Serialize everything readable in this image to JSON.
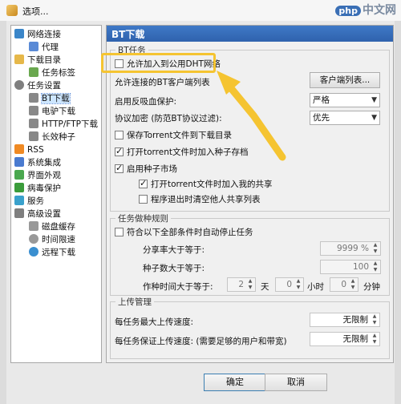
{
  "window": {
    "title": "选项..."
  },
  "watermark": {
    "badge": "php",
    "text": "中文网"
  },
  "tree": {
    "items": [
      {
        "label": "网络连接",
        "icon": "network-icon",
        "color": "#3b86c9"
      },
      {
        "label": "代理",
        "icon": "proxy-icon",
        "color": "#5a8ad6"
      },
      {
        "label": "下载目录",
        "icon": "folder-icon",
        "color": "#e6b84a"
      },
      {
        "label": "任务标签",
        "icon": "tag-icon",
        "color": "#6aa84f"
      },
      {
        "label": "任务设置",
        "icon": "gear-icon",
        "color": "#7f7f7f"
      },
      {
        "label": "BT下载",
        "icon": "bt-icon",
        "color": "#888888"
      },
      {
        "label": "电驴下载",
        "icon": "ed2k-icon",
        "color": "#888888"
      },
      {
        "label": "HTTP/FTP下载",
        "icon": "http-icon",
        "color": "#888888"
      },
      {
        "label": "长效种子",
        "icon": "seed-icon",
        "color": "#888888"
      },
      {
        "label": "RSS",
        "icon": "rss-icon",
        "color": "#f08a24"
      },
      {
        "label": "系统集成",
        "icon": "integration-icon",
        "color": "#4a7bd0"
      },
      {
        "label": "界面外观",
        "icon": "appearance-icon",
        "color": "#4aa84f"
      },
      {
        "label": "病毒保护",
        "icon": "shield-icon",
        "color": "#3b9c3b"
      },
      {
        "label": "服务",
        "icon": "service-icon",
        "color": "#3aa1cc"
      },
      {
        "label": "高级设置",
        "icon": "advanced-icon",
        "color": "#7f7f7f"
      },
      {
        "label": "磁盘缓存",
        "icon": "disk-cache-icon",
        "color": "#999999"
      },
      {
        "label": "时间限速",
        "icon": "clock-icon",
        "color": "#999999"
      },
      {
        "label": "远程下载",
        "icon": "remote-icon",
        "color": "#3a8fd0"
      }
    ]
  },
  "panel": {
    "header": "BT下载",
    "bt_group": {
      "title": "BT任务",
      "dht_checkbox": {
        "label": "允许加入到公用DHT网络",
        "checked": false
      },
      "client_list_label": "允许连接的BT客户端列表",
      "client_list_button": "客户端列表...",
      "anti_leech_label": "启用反吸血保护:",
      "anti_leech_value": "严格",
      "protocol_label": "协议加密 (防范BT协议过滤):",
      "protocol_value": "优先",
      "save_torrent": {
        "label": "保存Torrent文件到下载目录",
        "checked": false
      },
      "open_torrent": {
        "label": "打开torrent文件时加入种子存档",
        "checked": true
      },
      "seed_market": {
        "label": "启用种子市场",
        "checked": true
      },
      "share_on_open": {
        "label": "打开torrent文件时加入我的共享",
        "checked": true
      },
      "clear_on_exit": {
        "label": "程序退出时清空他人共享列表",
        "checked": false
      }
    },
    "seed_rule_group": {
      "title": "任务做种规则",
      "stop_checkbox": {
        "label": "符合以下全部条件时自动停止任务",
        "checked": false
      },
      "share_ratio_label": "分享率大于等于:",
      "share_ratio_value": "9999 %",
      "seed_count_label": "种子数大于等于:",
      "seed_count_value": "100",
      "seed_time_label": "作种时间大于等于:",
      "days_value": "2",
      "days_unit": "天",
      "hours_value": "0",
      "hours_unit": "小时",
      "minutes_value": "0",
      "minutes_unit": "分钟"
    },
    "upload_group": {
      "title": "上传管理",
      "max_upload_label": "每任务最大上传速度:",
      "max_upload_value": "无限制",
      "min_upload_label": "每任务保证上传速度: (需要足够的用户和带宽)",
      "min_upload_value": "无限制"
    }
  },
  "buttons": {
    "ok": "确定",
    "cancel": "取消"
  },
  "colors": {
    "header_blue": "#3f79c7",
    "highlight": "#f5c431"
  }
}
